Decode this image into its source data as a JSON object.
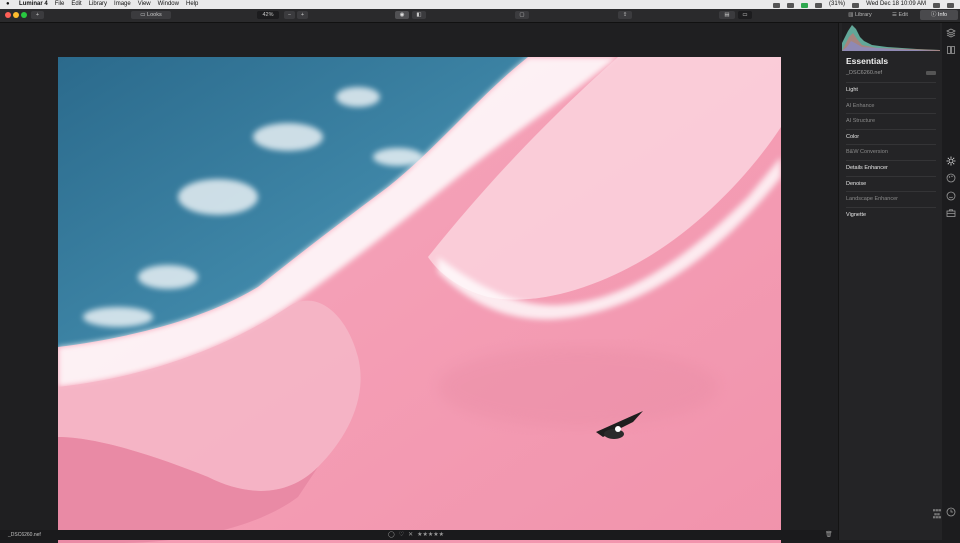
{
  "menubar": {
    "app_name": "Luminar 4",
    "menus": [
      "File",
      "Edit",
      "Library",
      "Image",
      "View",
      "Window",
      "Help"
    ],
    "battery": "(31%)",
    "datetime": "Wed Dec 18  10:09 AM"
  },
  "toolbar": {
    "add_label": "+",
    "looks_label": "Looks",
    "zoom_value": "42%",
    "zoom_out_label": "−",
    "zoom_in_label": "+",
    "tab_library": "Library",
    "tab_edit": "Edit",
    "tab_info": "Info"
  },
  "panel": {
    "title": "Essentials",
    "filename": "_DSC6260.nef",
    "tools": [
      {
        "label": "Light",
        "enabled": true
      },
      {
        "label": "AI Enhance",
        "enabled": false
      },
      {
        "label": "AI Structure",
        "enabled": false
      },
      {
        "label": "Color",
        "enabled": true
      },
      {
        "label": "B&W Conversion",
        "enabled": false
      },
      {
        "label": "Details Enhancer",
        "enabled": true
      },
      {
        "label": "Denoise",
        "enabled": true
      },
      {
        "label": "Landscape Enhancer",
        "enabled": false
      },
      {
        "label": "Vignette",
        "enabled": true
      }
    ]
  },
  "bottombar": {
    "filename": "_DSC6260.nef",
    "rating_stars": "★★★★★",
    "reject_label": "✕"
  },
  "icons": {
    "layers": "layers-icon",
    "canvas": "canvas-icon",
    "essentials": "sun-icon",
    "creative": "palette-icon",
    "portrait": "face-icon",
    "pro": "briefcase-icon",
    "history": "clock-icon"
  },
  "colors": {
    "accent_pink": "#f09ab0",
    "water_teal": "#2c6f8e"
  }
}
